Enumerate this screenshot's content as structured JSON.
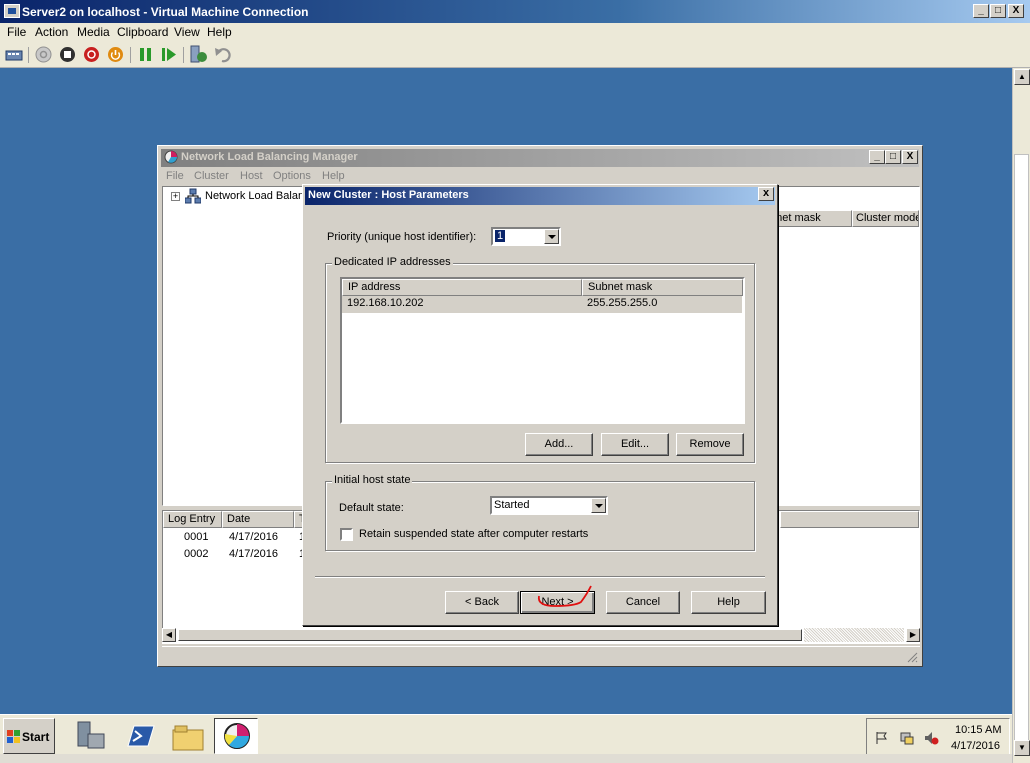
{
  "vm_window": {
    "title": "Server2 on localhost - Virtual Machine Connection",
    "menu": [
      "File",
      "Action",
      "Media",
      "Clipboard",
      "View",
      "Help"
    ],
    "caption_buttons": [
      "_",
      "□",
      "X"
    ]
  },
  "toolbar_icons": [
    "ctrl-alt-del-icon",
    "start-icon",
    "turn-off-icon",
    "shutdown-icon",
    "power-icon",
    "pause-icon",
    "resume-icon",
    "snapshot-icon",
    "revert-icon"
  ],
  "nlb_manager": {
    "title": "Network Load Balancing Manager",
    "menu": [
      "File",
      "Cluster",
      "Host",
      "Options",
      "Help"
    ],
    "tree_root": "Network Load Balanc",
    "right_columns": [
      "bnet mask",
      "Cluster mode"
    ],
    "log_columns": [
      "Log Entry",
      "Date",
      "T"
    ],
    "log_rows": [
      {
        "entry": "0001",
        "date": "4/17/2016",
        "t": "1"
      },
      {
        "entry": "0002",
        "date": "4/17/2016",
        "t": "1"
      }
    ]
  },
  "dialog": {
    "title": "New Cluster : Host Parameters",
    "close_label": "x",
    "priority_label": "Priority (unique host identifier):",
    "priority_value": "1",
    "dedicated_group_title": "Dedicated IP addresses",
    "ip_columns": [
      "IP address",
      "Subnet mask"
    ],
    "ip_rows": [
      {
        "ip": "192.168.10.202",
        "mask": "255.255.255.0"
      }
    ],
    "add_label": "Add...",
    "edit_label": "Edit...",
    "remove_label": "Remove",
    "initial_state_group_title": "Initial host state",
    "default_state_label": "Default state:",
    "default_state_value": "Started",
    "retain_label": "Retain suspended state after computer restarts",
    "retain_checked": false,
    "back_label": "< Back",
    "next_label": "Next >",
    "cancel_label": "Cancel",
    "help_label": "Help"
  },
  "taskbar": {
    "start_label": "Start",
    "apps": [
      "server-manager-icon",
      "powershell-icon",
      "explorer-icon",
      "nlb-manager-icon"
    ],
    "tray_icons": [
      "flag-icon",
      "network-icon",
      "volume-icon"
    ],
    "time": "10:15 AM",
    "date": "4/17/2016"
  },
  "colors": {
    "desktop": "#3a6ea5",
    "title_active": "#0a246a",
    "annotation_red": "#e01010"
  }
}
